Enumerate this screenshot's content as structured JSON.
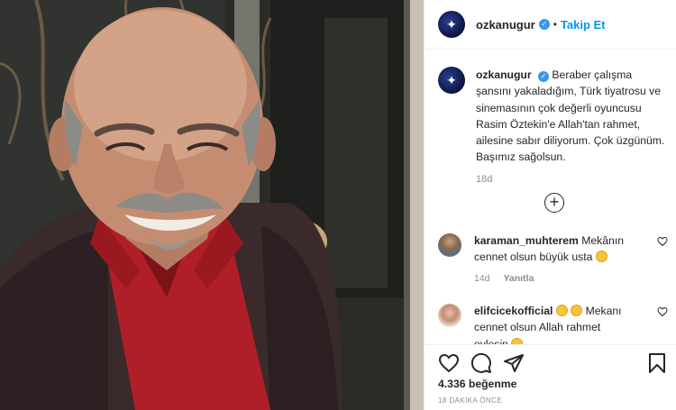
{
  "header": {
    "username": "ozkanugur",
    "verified_glyph": "✓",
    "separator": "•",
    "follow_label": "Takip Et"
  },
  "caption": {
    "username": "ozkanugur",
    "text": "Beraber çalışma şansını yakaladığım, Türk tiyatrosu ve sinemasının çok değerli oyuncusu Rasim Öztekin'e Allah'tan rahmet, ailesine sabır diliyorum. Çok üzgünüm. Başımız sağolsun.",
    "time": "18d"
  },
  "load_more": {
    "glyph": "+"
  },
  "comments": [
    {
      "username": "karaman_muhterem",
      "text": "Mekânın cennet olsun büyük usta",
      "time": "14d",
      "reply_label": "Yanıtla"
    },
    {
      "username": "elifcicekofficial",
      "text": "Mekanı cennet olsun Allah rahmet eylesin"
    }
  ],
  "actions": {
    "icons": [
      "heart-icon",
      "comment-icon",
      "share-icon",
      "bookmark-icon"
    ]
  },
  "likes": {
    "count": "4.336",
    "label": "beğenme"
  },
  "posted": "18 DAKİKA ÖNCE",
  "colors": {
    "accent": "#0095f6",
    "verified": "#3897f0",
    "text": "#262626",
    "muted": "#8e8e8e"
  }
}
